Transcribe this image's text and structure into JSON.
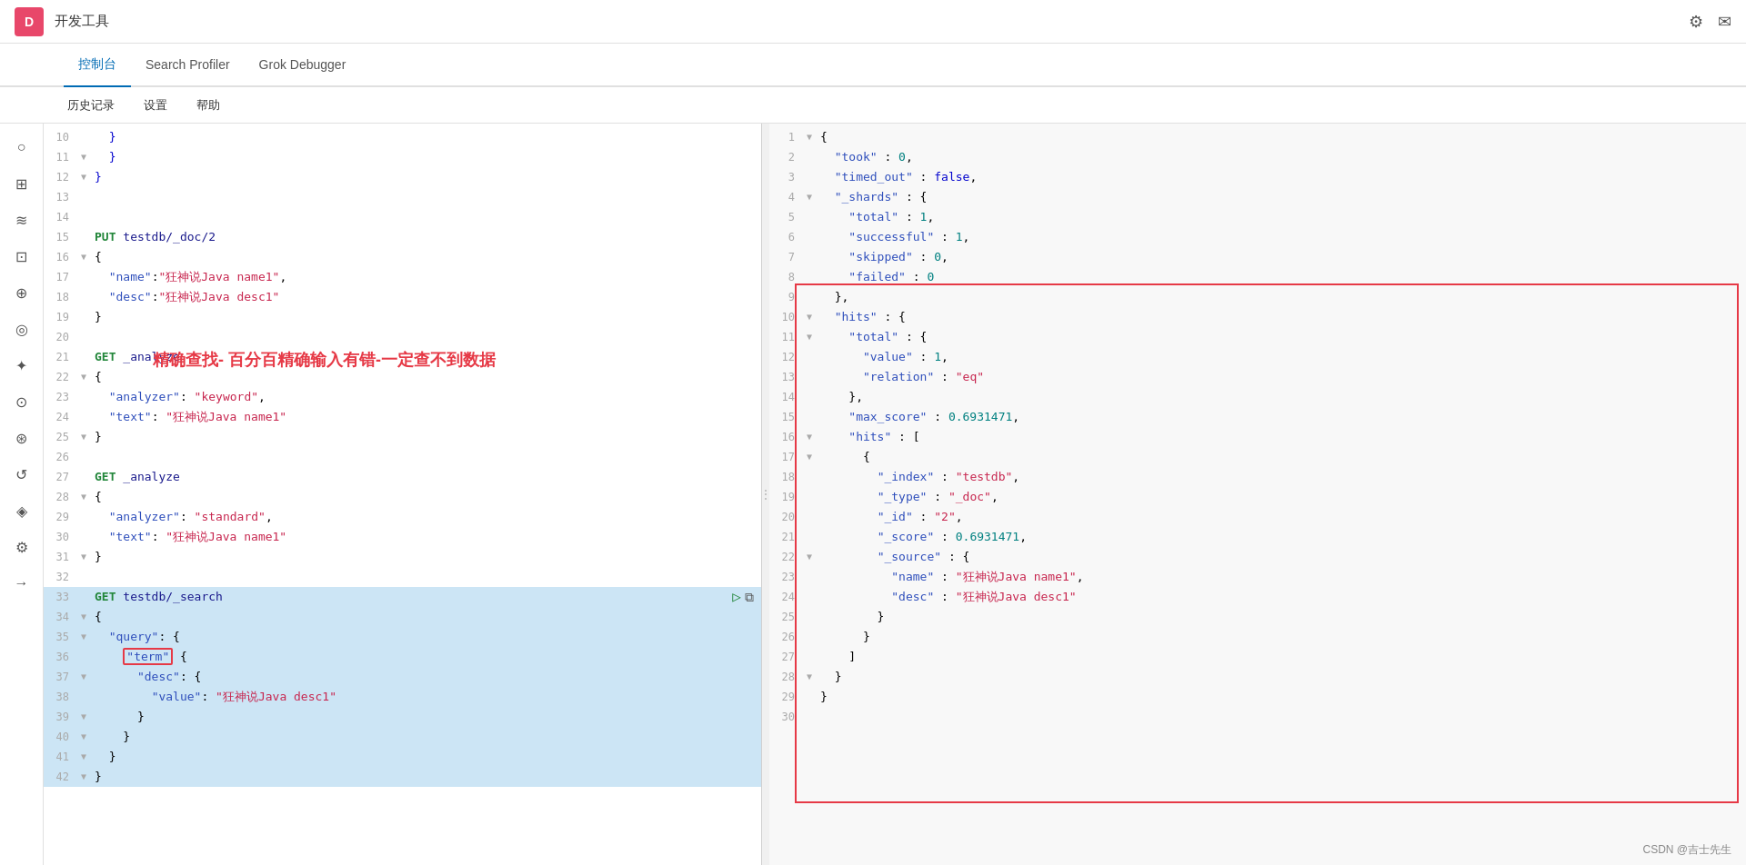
{
  "header": {
    "logo": "D",
    "title": "开发工具",
    "icons": [
      "⚙",
      "✉"
    ]
  },
  "nav": {
    "tabs": [
      "控制台",
      "Search Profiler",
      "Grok Debugger"
    ],
    "active": 0
  },
  "subtoolbar": {
    "items": [
      "历史记录",
      "设置",
      "帮助"
    ]
  },
  "sidebar_icons": [
    "○",
    "▦",
    "≡",
    "⊞",
    "⊕",
    "⊙",
    "♦",
    "△",
    "⊡",
    "↕",
    "⊛",
    "⊗"
  ],
  "overlay_text": "精确查找- 百分百精确输入有错-一定查不到数据",
  "editor_lines": [
    {
      "num": 10,
      "arrow": "",
      "code": "  }",
      "highlight": false
    },
    {
      "num": 11,
      "arrow": "▼",
      "code": "  }",
      "highlight": false
    },
    {
      "num": 12,
      "arrow": "▼",
      "code": "}",
      "highlight": false
    },
    {
      "num": 13,
      "arrow": "",
      "code": "",
      "highlight": false
    },
    {
      "num": 14,
      "arrow": "",
      "code": "",
      "highlight": false
    },
    {
      "num": 15,
      "arrow": "",
      "code": "PUT testdb/_doc/2",
      "highlight": false
    },
    {
      "num": 16,
      "arrow": "▼",
      "code": "{",
      "highlight": false
    },
    {
      "num": 17,
      "arrow": "",
      "code": "  \"name\":\"狂神说Java name1\",",
      "highlight": false
    },
    {
      "num": 18,
      "arrow": "",
      "code": "  \"desc\":\"狂神说Java desc1\"",
      "highlight": false
    },
    {
      "num": 19,
      "arrow": "",
      "code": "}",
      "highlight": false
    },
    {
      "num": 20,
      "arrow": "",
      "code": "",
      "highlight": false
    },
    {
      "num": 21,
      "arrow": "",
      "code": "GET _analyze",
      "highlight": false
    },
    {
      "num": 22,
      "arrow": "▼",
      "code": "{",
      "highlight": false
    },
    {
      "num": 23,
      "arrow": "",
      "code": "  \"analyzer\": \"keyword\",",
      "highlight": false
    },
    {
      "num": 24,
      "arrow": "",
      "code": "  \"text\": \"狂神说Java name1\"",
      "highlight": false
    },
    {
      "num": 25,
      "arrow": "▼",
      "code": "}",
      "highlight": false
    },
    {
      "num": 26,
      "arrow": "",
      "code": "",
      "highlight": false
    },
    {
      "num": 27,
      "arrow": "",
      "code": "GET _analyze",
      "highlight": false
    },
    {
      "num": 28,
      "arrow": "▼",
      "code": "{",
      "highlight": false
    },
    {
      "num": 29,
      "arrow": "",
      "code": "  \"analyzer\": \"standard\",",
      "highlight": false
    },
    {
      "num": 30,
      "arrow": "",
      "code": "  \"text\": \"狂神说Java name1\"",
      "highlight": false
    },
    {
      "num": 31,
      "arrow": "▼",
      "code": "}",
      "highlight": false
    },
    {
      "num": 32,
      "arrow": "",
      "code": "",
      "highlight": false
    },
    {
      "num": 33,
      "arrow": "",
      "code": "GET testdb/_search",
      "highlight": true
    },
    {
      "num": 34,
      "arrow": "▼",
      "code": "{",
      "highlight": true
    },
    {
      "num": 35,
      "arrow": "▼",
      "code": "  \"query\": {",
      "highlight": true
    },
    {
      "num": 36,
      "arrow": "",
      "code": "    \"term\" {",
      "highlight": true,
      "has_term_box": true
    },
    {
      "num": 37,
      "arrow": "▼",
      "code": "      \"desc\": {",
      "highlight": true
    },
    {
      "num": 38,
      "arrow": "",
      "code": "        \"value\": \"狂神说Java desc1\"",
      "highlight": true
    },
    {
      "num": 39,
      "arrow": "▼",
      "code": "      }",
      "highlight": true
    },
    {
      "num": 40,
      "arrow": "▼",
      "code": "    }",
      "highlight": true
    },
    {
      "num": 41,
      "arrow": "▼",
      "code": "  }",
      "highlight": true
    },
    {
      "num": 42,
      "arrow": "▼",
      "code": "}",
      "highlight": true
    }
  ],
  "result_lines": [
    {
      "num": 1,
      "arrow": "▼",
      "code": "{"
    },
    {
      "num": 2,
      "arrow": "",
      "code": "  \"took\" : 0,"
    },
    {
      "num": 3,
      "arrow": "",
      "code": "  \"timed_out\" : false,"
    },
    {
      "num": 4,
      "arrow": "▼",
      "code": "  \"_shards\" : {"
    },
    {
      "num": 5,
      "arrow": "",
      "code": "    \"total\" : 1,"
    },
    {
      "num": 6,
      "arrow": "",
      "code": "    \"successful\" : 1,"
    },
    {
      "num": 7,
      "arrow": "",
      "code": "    \"skipped\" : 0,"
    },
    {
      "num": 8,
      "arrow": "",
      "code": "    \"failed\" : 0"
    },
    {
      "num": 9,
      "arrow": "",
      "code": "  },"
    },
    {
      "num": 10,
      "arrow": "▼",
      "code": "  \"hits\" : {"
    },
    {
      "num": 11,
      "arrow": "▼",
      "code": "    \"total\" : {"
    },
    {
      "num": 12,
      "arrow": "",
      "code": "      \"value\" : 1,"
    },
    {
      "num": 13,
      "arrow": "",
      "code": "      \"relation\" : \"eq\""
    },
    {
      "num": 14,
      "arrow": "",
      "code": "    },"
    },
    {
      "num": 15,
      "arrow": "",
      "code": "    \"max_score\" : 0.6931471,"
    },
    {
      "num": 16,
      "arrow": "▼",
      "code": "    \"hits\" : ["
    },
    {
      "num": 17,
      "arrow": "▼",
      "code": "      {"
    },
    {
      "num": 18,
      "arrow": "",
      "code": "        \"_index\" : \"testdb\","
    },
    {
      "num": 19,
      "arrow": "",
      "code": "        \"_type\" : \"_doc\","
    },
    {
      "num": 20,
      "arrow": "",
      "code": "        \"_id\" : \"2\","
    },
    {
      "num": 21,
      "arrow": "",
      "code": "        \"_score\" : 0.6931471,"
    },
    {
      "num": 22,
      "arrow": "▼",
      "code": "        \"_source\" : {"
    },
    {
      "num": 23,
      "arrow": "",
      "code": "          \"name\" : \"狂神说Java name1\","
    },
    {
      "num": 24,
      "arrow": "",
      "code": "          \"desc\" : \"狂神说Java desc1\""
    },
    {
      "num": 25,
      "arrow": "",
      "code": "        }"
    },
    {
      "num": 26,
      "arrow": "",
      "code": "      }"
    },
    {
      "num": 27,
      "arrow": "",
      "code": "    ]"
    },
    {
      "num": 28,
      "arrow": "▼",
      "code": "  }"
    },
    {
      "num": 29,
      "arrow": "",
      "code": "}"
    },
    {
      "num": 30,
      "arrow": "",
      "code": ""
    }
  ],
  "attribution": "CSDN @吉士先生"
}
